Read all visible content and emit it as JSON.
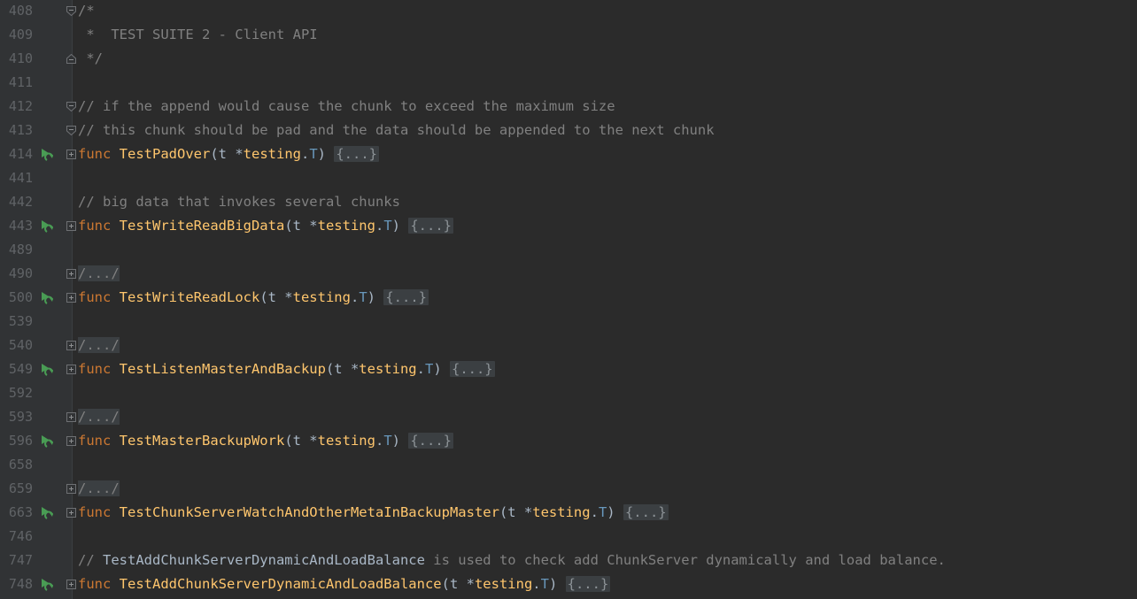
{
  "editor": {
    "colors": {
      "background": "#2b2b2b",
      "gutter": "#313335",
      "keyword": "#cc7832",
      "function": "#ffc66d",
      "comment": "#808080",
      "run_icon": "#499c54"
    },
    "lines": [
      {
        "num": "408",
        "comment": "/*"
      },
      {
        "num": "409",
        "comment": " *  TEST SUITE 2 - Client API"
      },
      {
        "num": "410",
        "comment": " */"
      },
      {
        "num": "411"
      },
      {
        "num": "412",
        "comment": "// if the append would cause the chunk to exceed the maximum size"
      },
      {
        "num": "413",
        "comment": "// this chunk should be pad and the data should be appended to the next chunk"
      },
      {
        "num": "414",
        "keyword": "func",
        "name": "TestPadOver",
        "params_open": "(t *",
        "pkg": "testing",
        "dot": ".",
        "type": "T",
        "params_close": ") ",
        "body": "{...}"
      },
      {
        "num": "441"
      },
      {
        "num": "442",
        "comment": "// big data that invokes several chunks"
      },
      {
        "num": "443",
        "keyword": "func",
        "name": "TestWriteReadBigData",
        "params_open": "(t *",
        "pkg": "testing",
        "dot": ".",
        "type": "T",
        "params_close": ") ",
        "body": "{...}"
      },
      {
        "num": "489"
      },
      {
        "num": "490",
        "collapsed_comment": "/.../"
      },
      {
        "num": "500",
        "keyword": "func",
        "name": "TestWriteReadLock",
        "params_open": "(t *",
        "pkg": "testing",
        "dot": ".",
        "type": "T",
        "params_close": ") ",
        "body": "{...}"
      },
      {
        "num": "539"
      },
      {
        "num": "540",
        "collapsed_comment": "/.../"
      },
      {
        "num": "549",
        "keyword": "func",
        "name": "TestListenMasterAndBackup",
        "params_open": "(t *",
        "pkg": "testing",
        "dot": ".",
        "type": "T",
        "params_close": ") ",
        "body": "{...}"
      },
      {
        "num": "592"
      },
      {
        "num": "593",
        "collapsed_comment": "/.../"
      },
      {
        "num": "596",
        "keyword": "func",
        "name": "TestMasterBackupWork",
        "params_open": "(t *",
        "pkg": "testing",
        "dot": ".",
        "type": "T",
        "params_close": ") ",
        "body": "{...}"
      },
      {
        "num": "658"
      },
      {
        "num": "659",
        "collapsed_comment": "/.../"
      },
      {
        "num": "663",
        "keyword": "func",
        "name": "TestChunkServerWatchAndOtherMetaInBackupMaster",
        "params_open": "(t *",
        "pkg": "testing",
        "dot": ".",
        "type": "T",
        "params_close": ") ",
        "body": "{...}"
      },
      {
        "num": "746"
      },
      {
        "num": "747",
        "comment_prefix": "// ",
        "comment_ref": "TestAddChunkServerDynamicAndLoadBalance",
        "comment_suffix": " is used to check add ChunkServer dynamically and load balance."
      },
      {
        "num": "748",
        "keyword": "func",
        "name": "TestAddChunkServerDynamicAndLoadBalance",
        "params_open": "(t *",
        "pkg": "testing",
        "dot": ".",
        "type": "T",
        "params_close": ") ",
        "body": "{...}"
      }
    ]
  }
}
